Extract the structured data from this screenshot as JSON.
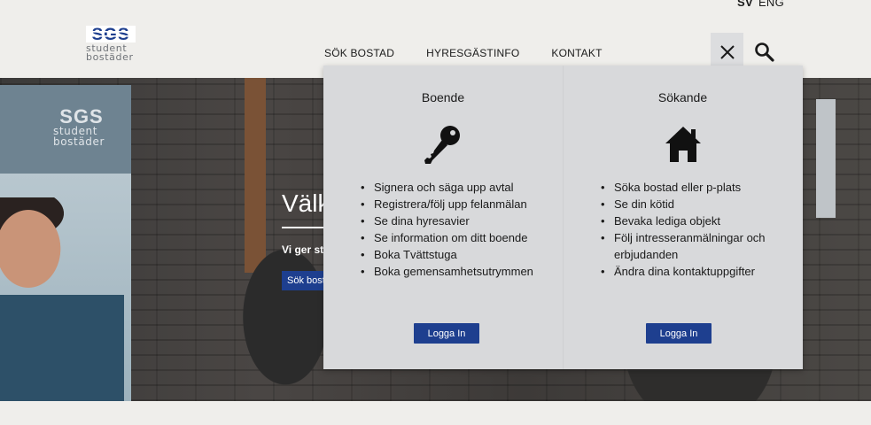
{
  "lang": {
    "sv": "SV",
    "en": "ENG"
  },
  "logo": {
    "mark_text": "SGS",
    "line1": "student",
    "line2": "bostäder"
  },
  "nav": {
    "items": [
      "SÖK BOSTAD",
      "HYRESGÄSTINFO",
      "KONTAKT"
    ]
  },
  "header_icons": {
    "close": "close-icon",
    "search": "search-icon"
  },
  "hero": {
    "title": "Välk",
    "subtitle": "Vi ger st",
    "button_label": "Sök bost",
    "banner_logo": {
      "mark_text": "SGS",
      "line1": "student",
      "line2": "bostäder"
    }
  },
  "dropdown": {
    "columns": [
      {
        "title": "Boende",
        "icon": "key-icon",
        "items": [
          "Signera och säga upp avtal",
          "Registrera/följ upp felanmälan",
          "Se dina hyresavier",
          "Se information om ditt boende",
          "Boka Tvättstuga",
          "Boka gemensamhetsutrymmen"
        ],
        "button_label": "Logga In"
      },
      {
        "title": "Sökande",
        "icon": "house-icon",
        "items": [
          "Söka bostad eller p-plats",
          "Se din kötid",
          "Bevaka lediga objekt",
          "Följ intresseranmälningar och erbjudanden",
          "Ändra dina kontaktuppgifter"
        ],
        "button_label": "Logga In"
      }
    ]
  },
  "colors": {
    "accent": "#1e3f8f",
    "logo_blue": "#1e3f8f",
    "panel_bg": "#d8d9db",
    "page_bg": "#efeeeb"
  }
}
